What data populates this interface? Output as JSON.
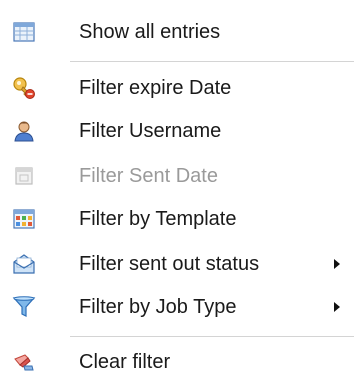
{
  "menu": {
    "items": [
      {
        "label": "Show all entries",
        "icon": "table-icon",
        "enabled": true,
        "submenu": false
      },
      {
        "label": "Filter expire Date",
        "icon": "key-icon",
        "enabled": true,
        "submenu": false
      },
      {
        "label": "Filter Username",
        "icon": "user-icon",
        "enabled": true,
        "submenu": false
      },
      {
        "label": "Filter Sent Date",
        "icon": "calendar-icon",
        "enabled": false,
        "submenu": false
      },
      {
        "label": "Filter by Template",
        "icon": "template-grid-icon",
        "enabled": true,
        "submenu": false
      },
      {
        "label": "Filter sent out status",
        "icon": "envelope-icon",
        "enabled": true,
        "submenu": true
      },
      {
        "label": "Filter by Job Type",
        "icon": "funnel-icon",
        "enabled": true,
        "submenu": true
      },
      {
        "label": "Clear filter",
        "icon": "clear-filter-icon",
        "enabled": true,
        "submenu": false
      }
    ]
  },
  "colors": {
    "text": "#1a1a1a",
    "disabled_text": "#9a9a9a",
    "separator": "#d4d4d4",
    "background": "#ffffff"
  }
}
